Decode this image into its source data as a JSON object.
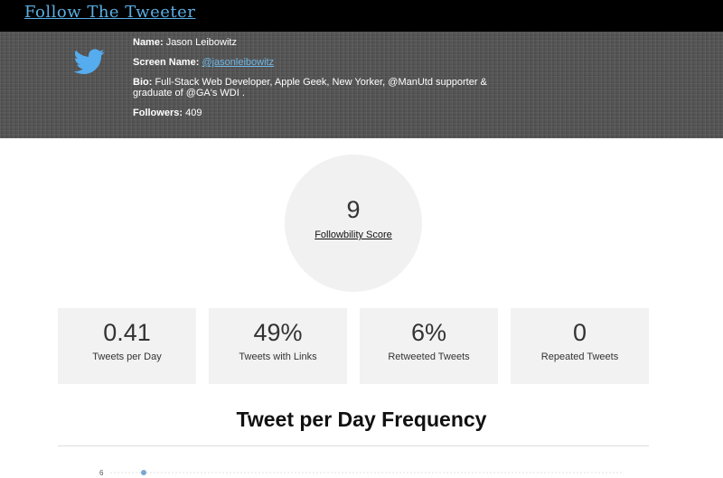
{
  "header": {
    "brand": "Follow The Tweeter"
  },
  "profile": {
    "icon": "twitter-bird-icon",
    "name_label": "Name:",
    "name": "Jason Leibowitz",
    "screen_name_label": "Screen Name:",
    "screen_name": "@jasonleibowitz",
    "bio_label": "Bio:",
    "bio": "Full-Stack Web Developer, Apple Geek, New Yorker, @ManUtd supporter & graduate of @GA's WDI .",
    "followers_label": "Followers:",
    "followers": "409"
  },
  "score": {
    "value": "9",
    "label": "Followbility Score"
  },
  "stats": [
    {
      "value": "0.41",
      "label": "Tweets per Day"
    },
    {
      "value": "49%",
      "label": "Tweets with Links"
    },
    {
      "value": "6%",
      "label": "Retweeted Tweets"
    },
    {
      "value": "0",
      "label": "Repeated Tweets"
    }
  ],
  "frequency": {
    "title": "Tweet per Day Frequency",
    "y_tick_top": "6"
  },
  "colors": {
    "accent": "#5aaee3",
    "topbar": "#000000",
    "card": "#f2f2f2"
  }
}
